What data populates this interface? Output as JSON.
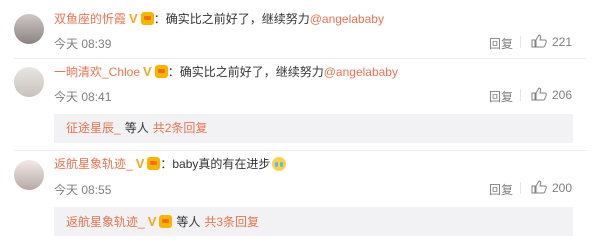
{
  "comments": [
    {
      "username": "双鱼座的忻霞",
      "text_before": "确实比之前好了，继续努力",
      "mention": "@angelababy",
      "time": "今天 08:39",
      "reply_label": "回复",
      "likes": "221"
    },
    {
      "username": "一晌清欢_Chloe",
      "text_before": "确实比之前好了，继续努力",
      "mention": "@angelababy",
      "time": "今天 08:41",
      "reply_label": "回复",
      "likes": "206",
      "replies": {
        "user": "征途星辰_",
        "suffix": "等人",
        "count_text": "共2条回复"
      }
    },
    {
      "username": "返航星象轨迹_",
      "text_before": "baby真的有在进步",
      "time": "今天 08:55",
      "reply_label": "回复",
      "likes": "200",
      "replies": {
        "user": "返航星象轨迹_",
        "suffix": "等人",
        "count_text": "共3条回复"
      }
    }
  ],
  "colon": "：",
  "colors": {
    "username": "#eb7350",
    "meta": "#808080",
    "reply_bg": "#f2f2f5"
  },
  "icons": [
    "verified-v-icon",
    "vip-badge-icon",
    "thumbs-up-icon",
    "crying-emoji-icon"
  ]
}
